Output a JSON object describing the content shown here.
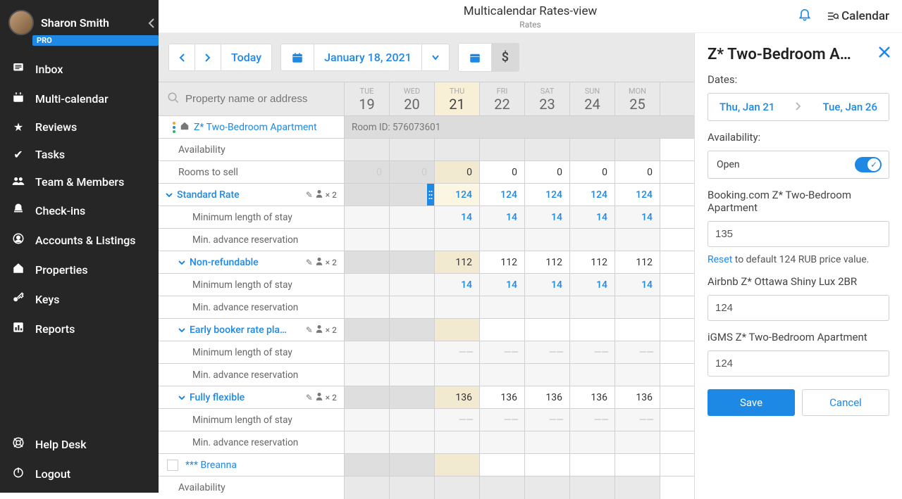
{
  "user": {
    "name": "Sharon Smith",
    "badge": "PRO"
  },
  "sidebar": {
    "items": [
      {
        "label": "Inbox"
      },
      {
        "label": "Multi-calendar"
      },
      {
        "label": "Reviews"
      },
      {
        "label": "Tasks"
      },
      {
        "label": "Team & Members"
      },
      {
        "label": "Check-ins"
      },
      {
        "label": "Accounts & Listings"
      },
      {
        "label": "Properties"
      },
      {
        "label": "Keys"
      },
      {
        "label": "Reports"
      }
    ],
    "footer": [
      {
        "label": "Help Desk"
      },
      {
        "label": "Logout"
      }
    ]
  },
  "topbar": {
    "title": "Multicalendar Rates-view",
    "subtitle": "Rates"
  },
  "top_right": {
    "calendar_label": "Calendar"
  },
  "toolbar": {
    "today_label": "Today",
    "date_label": "January 18, 2021"
  },
  "search": {
    "placeholder": "Property name or address"
  },
  "days": [
    {
      "dow": "TUE",
      "num": "19",
      "period": "past"
    },
    {
      "dow": "WED",
      "num": "20",
      "period": "past"
    },
    {
      "dow": "THU",
      "num": "21",
      "period": "today"
    },
    {
      "dow": "FRI",
      "num": "22",
      "period": "future"
    },
    {
      "dow": "SAT",
      "num": "23",
      "period": "future"
    },
    {
      "dow": "SUN",
      "num": "24",
      "period": "future"
    },
    {
      "dow": "MON",
      "num": "25",
      "period": "future"
    }
  ],
  "property": {
    "name": "Z* Two-Bedroom Apartment",
    "room_id_label": "Room ID: 576073601",
    "rows": {
      "availability_label": "Availability",
      "rooms_to_sell_label": "Rooms to sell",
      "rooms_to_sell": [
        "0",
        "0",
        "0",
        "0",
        "0",
        "0",
        "0"
      ]
    },
    "standard_rate": {
      "label": "Standard Rate",
      "badge_count": "× 2",
      "values": [
        "",
        "",
        "124",
        "124",
        "124",
        "124",
        "124"
      ],
      "min_stay_label": "Minimum length of stay",
      "min_stay": [
        "",
        "",
        "14",
        "14",
        "14",
        "14",
        "14"
      ],
      "min_advance_label": "Min. advance reservation"
    },
    "nonrefundable": {
      "label": "Non-refundable",
      "badge_count": "× 2",
      "values": [
        "",
        "",
        "112",
        "112",
        "112",
        "112",
        "112"
      ],
      "min_stay_label": "Minimum length of stay",
      "min_stay": [
        "",
        "",
        "14",
        "14",
        "14",
        "14",
        "14"
      ],
      "min_advance_label": "Min. advance reservation"
    },
    "early_booker": {
      "label": "Early booker rate plan (…",
      "badge_count": "× 2",
      "values": [
        "",
        "",
        "",
        "",
        "",
        "",
        ""
      ],
      "min_stay_label": "Minimum length of stay",
      "min_stay": [
        "",
        "",
        "— —",
        "— —",
        "— —",
        "— —",
        "— —"
      ],
      "min_advance_label": "Min. advance reservation"
    },
    "fully_flexible": {
      "label": "Fully flexible",
      "badge_count": "× 2",
      "values": [
        "",
        "",
        "136",
        "136",
        "136",
        "136",
        "136"
      ],
      "min_stay_label": "Minimum length of stay",
      "min_stay": [
        "",
        "",
        "— —",
        "— —",
        "— —",
        "— —",
        "— —"
      ],
      "min_advance_label": "Min. advance reservation"
    }
  },
  "second_property": {
    "name": "*** Breanna",
    "availability_label": "Availability"
  },
  "panel": {
    "title": "Z* Two-Bedroom A…",
    "dates_label": "Dates:",
    "date_from": "Thu, Jan 21",
    "date_to": "Tue, Jan 26",
    "availability_label": "Availability:",
    "availability_value": "Open",
    "channel_bdc_label": "Booking.com Z* Two-Bedroom Apartment",
    "channel_bdc_value": "135",
    "reset_link": "Reset",
    "reset_suffix": " to default 124 RUB price value.",
    "channel_air_label": "Airbnb Z* Ottawa Shiny Lux 2BR",
    "channel_air_value": "124",
    "channel_igms_label": "iGMS Z* Two-Bedroom Apartment",
    "channel_igms_value": "124",
    "save_label": "Save",
    "cancel_label": "Cancel"
  }
}
